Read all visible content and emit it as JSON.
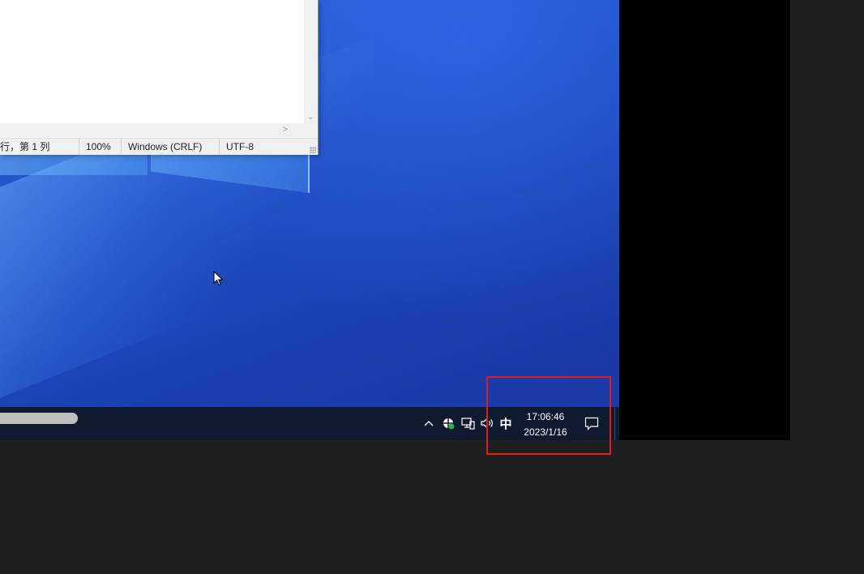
{
  "notepad": {
    "status": {
      "position": "行，第 1 列",
      "zoom": "100%",
      "line_ending": "Windows (CRLF)",
      "encoding": "UTF-8"
    }
  },
  "taskbar": {
    "tray": {
      "show_hidden_icon": "chevron-up-icon",
      "security_icon": "shield-icon",
      "network_icon": "network-icon",
      "volume_icon": "speaker-icon",
      "ime_label": "中",
      "notification_icon": "action-center-icon"
    },
    "clock": {
      "time": "17:06:46",
      "date": "2023/1/16"
    }
  },
  "colors": {
    "desktop_blue": "#1f4fc4",
    "taskbar": "#0f1a2e",
    "highlight": "#e01b1b",
    "outer_background": "#1f1f1f"
  }
}
